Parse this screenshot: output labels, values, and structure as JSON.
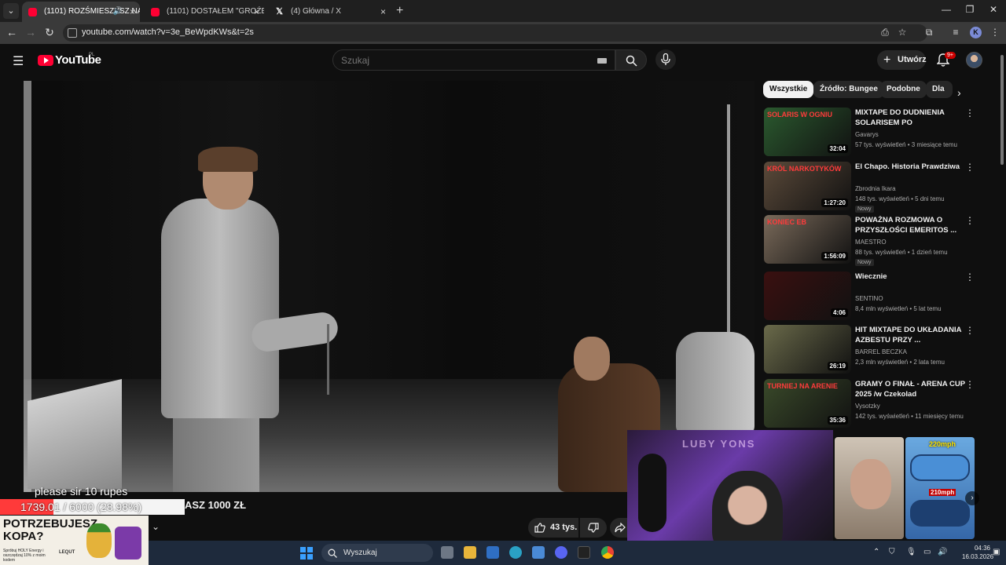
{
  "browser": {
    "tabs": [
      {
        "label": "(1101) ROZŚMIESZYSZ NAS",
        "active": true
      },
      {
        "label": "(1101) DOSTAŁEM \"GROŹBY PR",
        "active": false
      },
      {
        "label": "(4) Główna / X",
        "active": false
      }
    ],
    "url": "youtube.com/watch?v=3e_BeWpdKWs&t=2s",
    "profile_initial": "K"
  },
  "masthead": {
    "logo_text": "YouTube",
    "region": "PL",
    "search_placeholder": "Szukaj",
    "create_label": "Utwórz",
    "notification_count": "9+"
  },
  "player": {
    "chat_message": "please sir 10 rupes",
    "goal_text": "1739.01 / 6000 (28.98%)",
    "goal_fraction": 0.2898,
    "title_fragment": "ASZ 1000 ZŁ",
    "like_count": "43 tys."
  },
  "promo": {
    "headline": "POTRZEBUJESZ KOPA?",
    "subtext": "Spróbuj HOLY Energy i oszczędzaj 10% z moim kodem",
    "brand_code": "LEQUT"
  },
  "chips": [
    "Wszystkie",
    "Źródło: Bungee",
    "Podobne",
    "Dla"
  ],
  "recommendations": [
    {
      "title": "MIXTAPE DO DUDNIENIA SOLARISEM PO CHRZANOWIE...",
      "channel": "Gavarys",
      "meta": "57 tys. wyświetleń • 3 miesiące temu",
      "duration": "32:04",
      "badge": "",
      "thumb_text": "SOLARIS W OGNIU",
      "thumb_color": "#2b5a2f"
    },
    {
      "title": "El Chapo. Historia Prawdziwa",
      "channel": "Zbrodnia Ikara",
      "meta": "148 tys. wyświetleń • 5 dni temu",
      "duration": "1:27:20",
      "badge": "Nowy",
      "thumb_text": "KRÓL NARKOTYKÓW",
      "thumb_color": "#5b4a3a"
    },
    {
      "title": "POWAŻNA ROZMOWA O PRZYSZŁOŚCI EMERITOS ...",
      "channel": "MAESTRO",
      "meta": "88 tys. wyświetleń • 1 dzień temu",
      "duration": "1:56:09",
      "badge": "Nowy",
      "thumb_text": "KONIEC EB",
      "thumb_color": "#7a6a5a"
    },
    {
      "title": "Wiecznie",
      "channel": "SENTINO",
      "meta": "8,4 mln wyświetleń • 5 lat temu",
      "duration": "4:06",
      "badge": "",
      "thumb_text": "",
      "thumb_color": "#3a1010"
    },
    {
      "title": "HIT MIXTAPE DO UKŁADANIA AZBESTU PRZY ...",
      "channel": "BARREL BECZKA",
      "meta": "2,3 mln wyświetleń • 2 lata temu",
      "duration": "26:19",
      "badge": "",
      "thumb_text": "",
      "thumb_color": "#6a6a4a"
    },
    {
      "title": "GRAMY O FINAŁ - ARENA CUP 2025 /w Czekolad",
      "channel": "Vysotzky",
      "meta": "142 tys. wyświetleń • 11 miesięcy temu",
      "duration": "35:36",
      "badge": "",
      "thumb_text": "TURNIEJ NA ARENIE",
      "thumb_color": "#3a4a2a"
    }
  ],
  "cam": {
    "neon_text": "LUBY YONS",
    "speed_top": "220mph",
    "speed_mid": "210mph"
  },
  "taskbar": {
    "search_label": "Wyszukaj",
    "time": "04:36",
    "date": "16.03.2026"
  }
}
